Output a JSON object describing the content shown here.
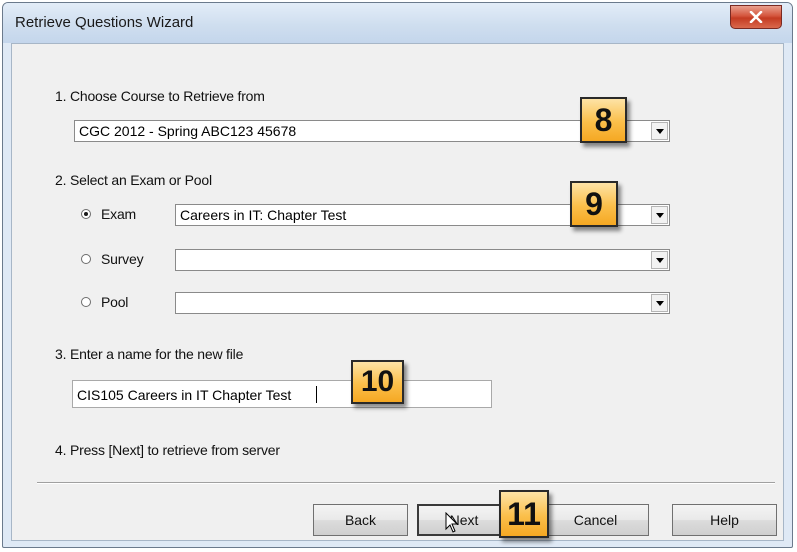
{
  "window": {
    "title": "Retrieve Questions Wizard"
  },
  "step1": {
    "label": "1.  Choose Course to Retrieve from",
    "course_value": "CGC 2012 - Spring ABC123 45678"
  },
  "step2": {
    "label": "2.  Select an Exam or Pool",
    "options": [
      {
        "label": "Exam",
        "selected": true,
        "value": "Careers in IT: Chapter Test"
      },
      {
        "label": "Survey",
        "selected": false,
        "value": ""
      },
      {
        "label": "Pool",
        "selected": false,
        "value": ""
      }
    ]
  },
  "step3": {
    "label": "3.  Enter a name for the new file",
    "filename_value": "CIS105 Careers in IT Chapter Test"
  },
  "step4": {
    "label": "4.  Press [Next] to retrieve from server"
  },
  "buttons": {
    "back": "Back",
    "next": "Next",
    "cancel": "Cancel",
    "help": "Help"
  },
  "callouts": {
    "course": "8",
    "exam": "9",
    "filename": "10",
    "next": "11"
  },
  "colors": {
    "callout_fill": "#fbbf4a",
    "close_button": "#c43b22"
  }
}
